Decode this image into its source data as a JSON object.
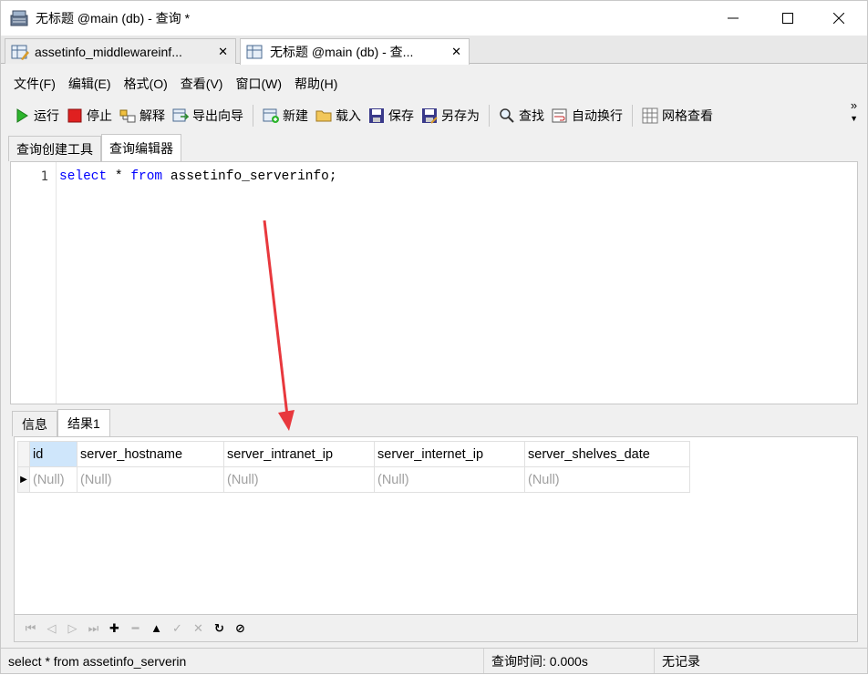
{
  "window": {
    "title": "无标题 @main (db) - 查询 *"
  },
  "tabs": [
    {
      "label": "assetinfo_middlewareinf..."
    },
    {
      "label": "无标题 @main (db) - 查..."
    }
  ],
  "menu": [
    "文件(F)",
    "编辑(E)",
    "格式(O)",
    "查看(V)",
    "窗口(W)",
    "帮助(H)"
  ],
  "toolbar": {
    "run": "运行",
    "stop": "停止",
    "explain": "解释",
    "export": "导出向导",
    "new": "新建",
    "load": "载入",
    "save": "保存",
    "save_as": "另存为",
    "find": "查找",
    "wrap": "自动换行",
    "grid": "网格查看"
  },
  "sub_tabs": [
    "查询创建工具",
    "查询编辑器"
  ],
  "editor": {
    "line_number": "1",
    "tokens": {
      "select": "select",
      "star": " * ",
      "from": "from",
      "rest": " assetinfo_serverinfo;"
    }
  },
  "result_tabs": [
    "信息",
    "结果1"
  ],
  "grid": {
    "columns": [
      "id",
      "server_hostname",
      "server_intranet_ip",
      "server_internet_ip",
      "server_shelves_date"
    ],
    "rows": [
      [
        "(Null)",
        "(Null)",
        "(Null)",
        "(Null)",
        "(Null)"
      ]
    ]
  },
  "status": {
    "sql": "select * from assetinfo_serverin",
    "time": "查询时间: 0.000s",
    "records": "无记录"
  },
  "colors": {
    "keyword": "#0000ff",
    "arrow": "#e8383d",
    "selected_header": "#cfe6fb"
  }
}
